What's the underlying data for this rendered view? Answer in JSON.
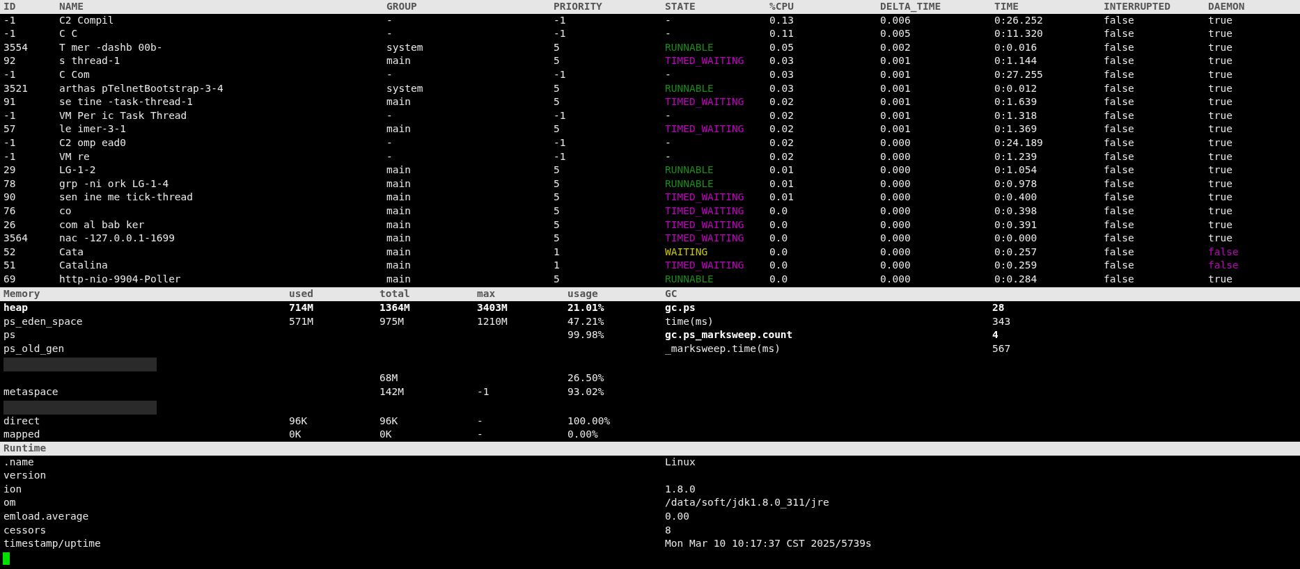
{
  "threads": {
    "columns": [
      "ID",
      "NAME",
      "GROUP",
      "PRIORITY",
      "STATE",
      "%CPU",
      "DELTA_TIME",
      "TIME",
      "INTERRUPTED",
      "DAEMON"
    ],
    "rows": [
      {
        "id": "-1",
        "name": "C2 Compil",
        "group": "-",
        "priority": "-1",
        "state": "-",
        "kind": "none",
        "cpu": "0.13",
        "delta": "0.006",
        "time": "0:26.252",
        "interrupted": "false",
        "daemon": "true",
        "daemon_highlighted": false
      },
      {
        "id": "-1",
        "name": "C C",
        "group": "-",
        "priority": "-1",
        "state": "-",
        "kind": "none",
        "cpu": "0.11",
        "delta": "0.005",
        "time": "0:11.320",
        "interrupted": "false",
        "daemon": "true",
        "daemon_highlighted": false
      },
      {
        "id": "3554",
        "name": "T mer -dashb 00b-",
        "group": "system",
        "priority": "5",
        "state": "RUNNABLE",
        "kind": "runnable",
        "cpu": "0.05",
        "delta": "0.002",
        "time": "0:0.016",
        "interrupted": "false",
        "daemon": "true",
        "daemon_highlighted": false
      },
      {
        "id": "92",
        "name": "s thread-1",
        "group": "main",
        "priority": "5",
        "state": "TIMED_WAITING",
        "kind": "timed_waiting",
        "cpu": "0.03",
        "delta": "0.001",
        "time": "0:1.144",
        "interrupted": "false",
        "daemon": "true",
        "daemon_highlighted": false
      },
      {
        "id": "-1",
        "name": "C Com",
        "group": "-",
        "priority": "-1",
        "state": "-",
        "kind": "none",
        "cpu": "0.03",
        "delta": "0.001",
        "time": "0:27.255",
        "interrupted": "false",
        "daemon": "true",
        "daemon_highlighted": false
      },
      {
        "id": "3521",
        "name": "arthas pTelnetBootstrap-3-4",
        "group": "system",
        "priority": "5",
        "state": "RUNNABLE",
        "kind": "runnable",
        "cpu": "0.03",
        "delta": "0.001",
        "time": "0:0.012",
        "interrupted": "false",
        "daemon": "true",
        "daemon_highlighted": false
      },
      {
        "id": "91",
        "name": "se tine -task-thread-1",
        "group": "main",
        "priority": "5",
        "state": "TIMED_WAITING",
        "kind": "timed_waiting",
        "cpu": "0.02",
        "delta": "0.001",
        "time": "0:1.639",
        "interrupted": "false",
        "daemon": "true",
        "daemon_highlighted": false
      },
      {
        "id": "-1",
        "name": "VM Per ic Task Thread",
        "group": "-",
        "priority": "-1",
        "state": "-",
        "kind": "none",
        "cpu": "0.02",
        "delta": "0.001",
        "time": "0:1.318",
        "interrupted": "false",
        "daemon": "true",
        "daemon_highlighted": false
      },
      {
        "id": "57",
        "name": "le imer-3-1",
        "group": "main",
        "priority": "5",
        "state": "TIMED_WAITING",
        "kind": "timed_waiting",
        "cpu": "0.02",
        "delta": "0.001",
        "time": "0:1.369",
        "interrupted": "false",
        "daemon": "true",
        "daemon_highlighted": false
      },
      {
        "id": "-1",
        "name": "C2 omp ead0",
        "group": "-",
        "priority": "-1",
        "state": "-",
        "kind": "none",
        "cpu": "0.02",
        "delta": "0.000",
        "time": "0:24.189",
        "interrupted": "false",
        "daemon": "true",
        "daemon_highlighted": false
      },
      {
        "id": "-1",
        "name": "VM re",
        "group": "-",
        "priority": "-1",
        "state": "-",
        "kind": "none",
        "cpu": "0.02",
        "delta": "0.000",
        "time": "0:1.239",
        "interrupted": "false",
        "daemon": "true",
        "daemon_highlighted": false
      },
      {
        "id": "29",
        "name": "LG-1-2",
        "group": "main",
        "priority": "5",
        "state": "RUNNABLE",
        "kind": "runnable",
        "cpu": "0.01",
        "delta": "0.000",
        "time": "0:1.054",
        "interrupted": "false",
        "daemon": "true",
        "daemon_highlighted": false
      },
      {
        "id": "78",
        "name": "grp -ni ork LG-1-4",
        "group": "main",
        "priority": "5",
        "state": "RUNNABLE",
        "kind": "runnable",
        "cpu": "0.01",
        "delta": "0.000",
        "time": "0:0.978",
        "interrupted": "false",
        "daemon": "true",
        "daemon_highlighted": false
      },
      {
        "id": "90",
        "name": "sen ine me tick-thread",
        "group": "main",
        "priority": "5",
        "state": "TIMED_WAITING",
        "kind": "timed_waiting",
        "cpu": "0.01",
        "delta": "0.000",
        "time": "0:0.400",
        "interrupted": "false",
        "daemon": "true",
        "daemon_highlighted": false
      },
      {
        "id": "76",
        "name": "co",
        "group": "main",
        "priority": "5",
        "state": "TIMED_WAITING",
        "kind": "timed_waiting",
        "cpu": "0.0",
        "delta": "0.000",
        "time": "0:0.398",
        "interrupted": "false",
        "daemon": "true",
        "daemon_highlighted": false
      },
      {
        "id": "26",
        "name": "com al bab ker",
        "group": "main",
        "priority": "5",
        "state": "TIMED_WAITING",
        "kind": "timed_waiting",
        "cpu": "0.0",
        "delta": "0.000",
        "time": "0:0.391",
        "interrupted": "false",
        "daemon": "true",
        "daemon_highlighted": false
      },
      {
        "id": "3564",
        "name": "nac -127.0.0.1-1699",
        "group": "main",
        "priority": "5",
        "state": "TIMED_WAITING",
        "kind": "timed_waiting",
        "cpu": "0.0",
        "delta": "0.000",
        "time": "0:0.000",
        "interrupted": "false",
        "daemon": "true",
        "daemon_highlighted": false
      },
      {
        "id": "52",
        "name": "Cata",
        "group": "main",
        "priority": "1",
        "state": "WAITING",
        "kind": "waiting",
        "cpu": "0.0",
        "delta": "0.000",
        "time": "0:0.257",
        "interrupted": "false",
        "daemon": "false",
        "daemon_highlighted": true
      },
      {
        "id": "51",
        "name": "Catalina",
        "group": "main",
        "priority": "1",
        "state": "TIMED_WAITING",
        "kind": "timed_waiting",
        "cpu": "0.0",
        "delta": "0.000",
        "time": "0:0.259",
        "interrupted": "false",
        "daemon": "false",
        "daemon_highlighted": true
      },
      {
        "id": "69",
        "name": "http-nio-9904-Poller",
        "group": "main",
        "priority": "5",
        "state": "RUNNABLE",
        "kind": "runnable",
        "cpu": "0.0",
        "delta": "0.000",
        "time": "0:0.284",
        "interrupted": "false",
        "daemon": "true",
        "daemon_highlighted": false
      }
    ]
  },
  "memory": {
    "columns": [
      "Memory",
      "used",
      "total",
      "max",
      "usage",
      "GC"
    ],
    "rows": [
      {
        "name": "heap",
        "used": "714M",
        "total": "1364M",
        "max": "3403M",
        "usage": "21.01%",
        "bold": true
      },
      {
        "name": "ps_eden_space",
        "used": "571M",
        "total": "975M",
        "max": "1210M",
        "usage": "47.21%",
        "bold": false
      },
      {
        "name": "ps",
        "usage": "99.98%",
        "bold": false
      },
      {
        "name": "ps_old_gen",
        "bold": false
      },
      {
        "redacted": true
      },
      {
        "total": "68M",
        "usage": "26.50%",
        "bold": false
      },
      {
        "name": "metaspace",
        "total": "142M",
        "max": "-1",
        "usage": "93.02%",
        "bold": false
      },
      {
        "redacted": true
      },
      {
        "name": "direct",
        "used": "96K",
        "total": "96K",
        "max": "-",
        "usage": "100.00%",
        "bold": false
      },
      {
        "name": "mapped",
        "used": "0K",
        "total": "0K",
        "max": "-",
        "usage": "0.00%",
        "bold": false
      }
    ]
  },
  "gc": {
    "rows": [
      {
        "name": "gc.ps",
        "value": "28",
        "bold": true
      },
      {
        "name": "time(ms)",
        "value": "343",
        "bold": false
      },
      {
        "name": "gc.ps_marksweep.count",
        "value": "4",
        "bold": true
      },
      {
        "name": "_marksweep.time(ms)",
        "value": "567",
        "bold": false
      }
    ]
  },
  "runtime": {
    "title": "Runtime",
    "rows": [
      {
        "name": ".name",
        "value": "Linux"
      },
      {
        "name": "version"
      },
      {
        "name": "ion",
        "value": "1.8.0"
      },
      {
        "name": "om",
        "value": "/data/soft/jdk1.8.0_311/jre"
      },
      {
        "name": "emload.average",
        "value": "0.00"
      },
      {
        "name": "cessors",
        "value": "8"
      },
      {
        "name": "timestamp/uptime",
        "value": "Mon Mar 10 10:17:37 CST 2025/5739s"
      }
    ]
  }
}
